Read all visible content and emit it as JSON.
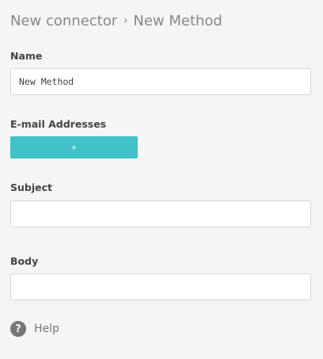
{
  "breadcrumb": {
    "parent": "New connector",
    "separator": "›",
    "current": "New Method"
  },
  "form": {
    "name": {
      "label": "Name",
      "value": "New Method"
    },
    "emails": {
      "label": "E-mail Addresses",
      "add_label": "+"
    },
    "subject": {
      "label": "Subject",
      "value": ""
    },
    "body": {
      "label": "Body",
      "value": ""
    }
  },
  "help": {
    "label": "Help",
    "icon": "?"
  },
  "colors": {
    "accent": "#40c2c8",
    "background": "#f5f5f5"
  }
}
